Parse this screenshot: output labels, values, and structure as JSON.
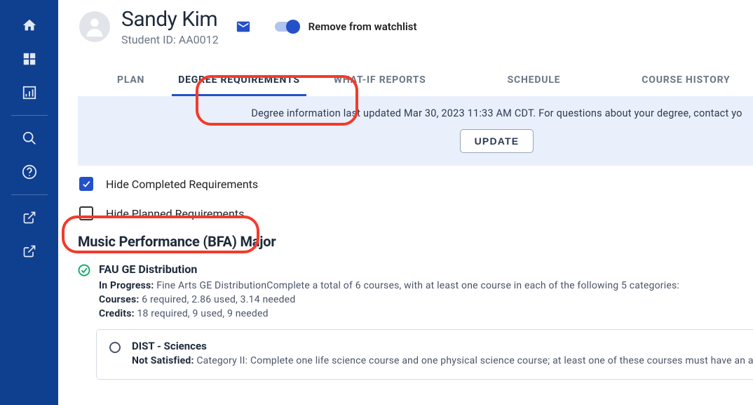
{
  "student": {
    "name": "Sandy Kim",
    "id_label": "Student ID: AA0012"
  },
  "watchlist_toggle_label": "Remove from watchlist",
  "tabs": {
    "plan": "PLAN",
    "degree_requirements": "DEGREE REQUIREMENTS",
    "what_if": "WHAT-IF REPORTS",
    "schedule": "SCHEDULE",
    "course_history": "COURSE HISTORY"
  },
  "info_bar": {
    "text": "Degree information last updated Mar 30, 2023 11:33 AM CDT. For questions about your degree, contact yo",
    "update_label": "UPDATE"
  },
  "filters": {
    "hide_completed": "Hide Completed Requirements",
    "hide_planned": "Hide Planned Requirements"
  },
  "major": {
    "title": "Music Performance (BFA) Major"
  },
  "requirement": {
    "title": "FAU GE Distribution",
    "in_progress_label": "In Progress:",
    "in_progress_text": " Fine Arts GE DistributionComplete a total of 6 courses, with at least one course in each of the following 5 categories:",
    "courses_label": "Courses:",
    "courses_text": " 6 required, 2.86 used, 3.14 needed",
    "credits_label": "Credits:",
    "credits_text": " 18 required, 9 used, 9 needed"
  },
  "sub_requirement": {
    "title": "DIST - Sciences",
    "not_satisfied_label": "Not Satisfied:",
    "not_satisfied_text": " Category II: Complete one life science course and one physical science course; at least one of these courses must have an a"
  }
}
